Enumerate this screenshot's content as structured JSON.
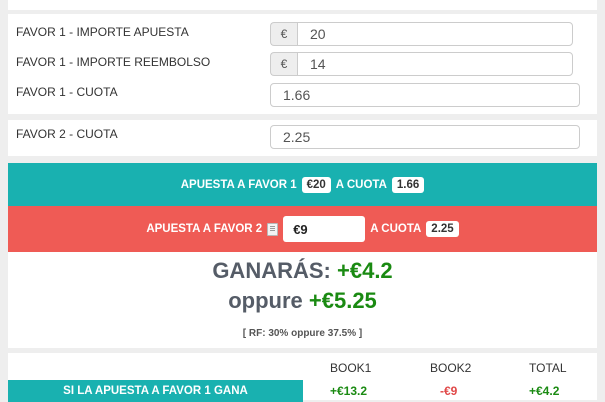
{
  "favor1": {
    "importe_apuesta_label": "FAVOR 1 - IMPORTE APUESTA",
    "importe_apuesta_value": "20",
    "importe_reembolso_label": "FAVOR 1 - IMPORTE REEMBOLSO",
    "importe_reembolso_value": "14",
    "cuota_label": "FAVOR 1 - CUOTA",
    "cuota_value": "1.66",
    "currency_symbol": "€"
  },
  "favor2": {
    "cuota_label": "FAVOR 2 - CUOTA",
    "cuota_value": "2.25"
  },
  "band1": {
    "prefix": "APUESTA A FAVOR 1",
    "stake": "€20",
    "cuota_text": "A CUOTA",
    "cuota": "1.66"
  },
  "band2": {
    "prefix": "APUESTA A FAVOR 2",
    "stake": "€9",
    "cuota_text": "A CUOTA",
    "cuota": "2.25",
    "icon": "clipboard-icon"
  },
  "result": {
    "ganaras_label": "GANARÁS:",
    "ganaras_value": "+€4.2",
    "oppure_label": "oppure",
    "oppure_value": "+€5.25",
    "rf_text": "[ RF: 30% oppure 37.5% ]"
  },
  "table": {
    "headers": [
      "BOOK1",
      "BOOK2",
      "TOTAL"
    ],
    "row1": {
      "label": "SI LA APUESTA A FAVOR 1 GANA",
      "book1": "+€13.2",
      "book2": "-€9",
      "total": "+€4.2"
    }
  },
  "colors": {
    "teal": "#19b1b0",
    "red": "#ef5b55",
    "positive": "#1a8a12",
    "negative": "#e04848"
  }
}
